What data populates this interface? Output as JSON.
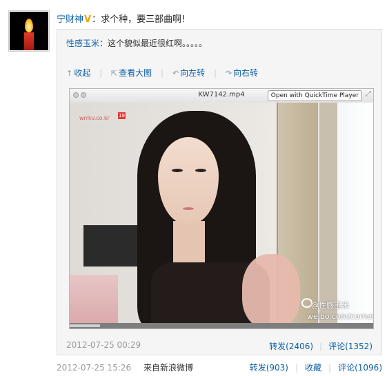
{
  "post": {
    "author": "宁财神",
    "verified_badge": "V",
    "text": "：求个种，要三部曲啊!",
    "time": "2012-07-25 15:26",
    "source": "来自新浪微博",
    "actions": {
      "repost": "转发(903)",
      "favorite": "收藏",
      "comment": "评论(1096)"
    }
  },
  "repost": {
    "author": "性感玉米",
    "text": "：这个貌似最近很红啊。。。。。",
    "tools": {
      "collapse": "收起",
      "view_large": "查看大图",
      "rotate_left": "向左转",
      "rotate_right": "向右转"
    },
    "media": {
      "filename": "KW7142.mp4",
      "qt_button": "Open with QuickTime Player",
      "tv_logo": "wrrkv.co.kr",
      "tv_badge": "19",
      "watermark_name": "@性感玉米",
      "watermark_url": "weibo.com/corndog",
      "progress_fraction": 0.1
    },
    "time": "2012-07-25 00:29",
    "actions": {
      "repost": "转发(2406)",
      "comment": "评论(1352)"
    }
  },
  "icons": {
    "collapse": "arrow-up-icon",
    "view_large": "external-link-icon",
    "rotate_left": "rotate-left-icon",
    "rotate_right": "rotate-right-icon"
  },
  "colors": {
    "link": "#0a5fa6",
    "verified": "#f0a000"
  }
}
